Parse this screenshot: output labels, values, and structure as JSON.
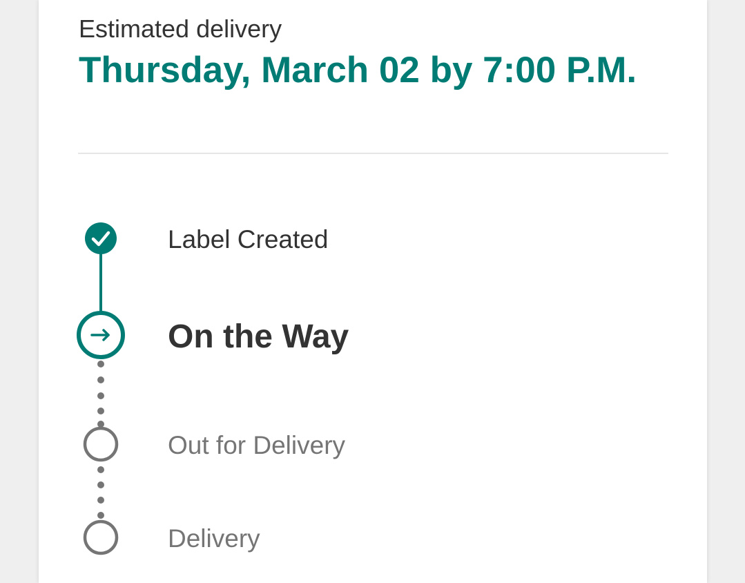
{
  "delivery": {
    "label": "Estimated delivery",
    "date": "Thursday, March 02 by 7:00 P.M."
  },
  "tracking": {
    "steps": [
      {
        "label": "Label Created",
        "status": "completed",
        "icon": "check-icon"
      },
      {
        "label": "On the Way",
        "status": "current",
        "icon": "arrow-right-icon"
      },
      {
        "label": "Out for Delivery",
        "status": "pending",
        "icon": "empty-circle-icon"
      },
      {
        "label": "Delivery",
        "status": "pending",
        "icon": "empty-circle-icon"
      }
    ]
  },
  "colors": {
    "accent": "#007c74",
    "pending": "#757575",
    "text": "#333333"
  }
}
